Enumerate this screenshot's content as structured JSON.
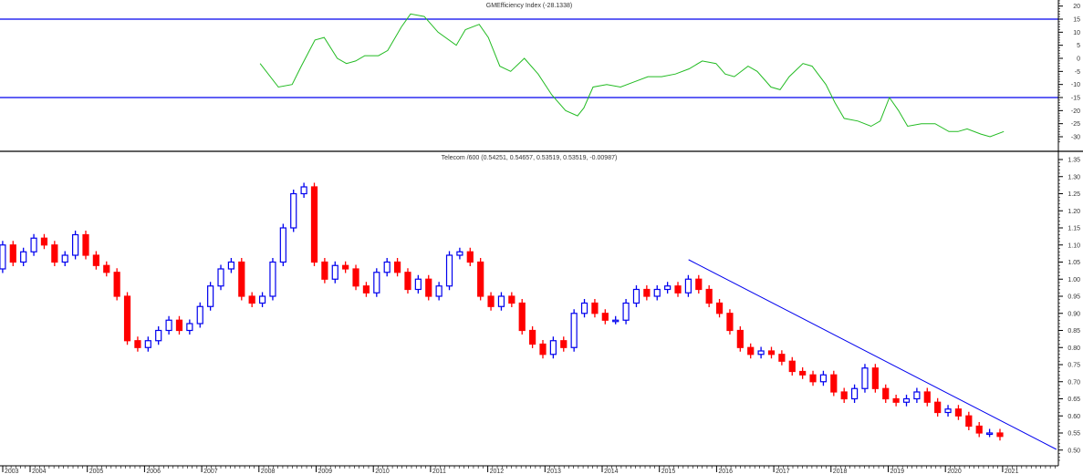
{
  "chart_data": [
    {
      "type": "line",
      "title": "GMEfficiency Index (-28.1338)",
      "yticks": [
        20,
        15,
        10,
        5,
        0,
        -5,
        -10,
        -15,
        -20,
        -25,
        -30
      ],
      "ylim": [
        -34,
        23
      ],
      "reference_lines": [
        15,
        -15
      ],
      "series": [
        {
          "name": "GMEfficiency Index",
          "color": "#22bb22",
          "points": [
            [
              2008.02,
              -2
            ],
            [
              2008.34,
              -11
            ],
            [
              2008.58,
              -10
            ],
            [
              2008.74,
              -3
            ],
            [
              2008.98,
              7
            ],
            [
              2009.14,
              8
            ],
            [
              2009.37,
              0
            ],
            [
              2009.53,
              -2
            ],
            [
              2009.69,
              -1
            ],
            [
              2009.85,
              1
            ],
            [
              2010.09,
              1
            ],
            [
              2010.25,
              3
            ],
            [
              2010.49,
              12
            ],
            [
              2010.65,
              17
            ],
            [
              2010.89,
              16
            ],
            [
              2011.13,
              10
            ],
            [
              2011.45,
              5
            ],
            [
              2011.61,
              11
            ],
            [
              2011.85,
              13
            ],
            [
              2012.01,
              8
            ],
            [
              2012.21,
              -3
            ],
            [
              2012.4,
              -5
            ],
            [
              2012.64,
              0
            ],
            [
              2012.88,
              -6
            ],
            [
              2013.12,
              -14
            ],
            [
              2013.36,
              -20
            ],
            [
              2013.57,
              -22
            ],
            [
              2013.68,
              -19
            ],
            [
              2013.84,
              -11
            ],
            [
              2014.08,
              -10
            ],
            [
              2014.32,
              -11
            ],
            [
              2014.56,
              -9
            ],
            [
              2014.8,
              -7
            ],
            [
              2015.04,
              -7
            ],
            [
              2015.28,
              -6
            ],
            [
              2015.52,
              -4
            ],
            [
              2015.75,
              -1
            ],
            [
              2015.99,
              -2
            ],
            [
              2016.15,
              -6
            ],
            [
              2016.31,
              -7
            ],
            [
              2016.55,
              -3
            ],
            [
              2016.71,
              -5
            ],
            [
              2016.95,
              -11
            ],
            [
              2017.11,
              -12
            ],
            [
              2017.27,
              -7
            ],
            [
              2017.51,
              -2
            ],
            [
              2017.67,
              -3
            ],
            [
              2017.91,
              -10
            ],
            [
              2018.07,
              -17
            ],
            [
              2018.23,
              -23
            ],
            [
              2018.47,
              -24
            ],
            [
              2018.7,
              -26
            ],
            [
              2018.86,
              -24
            ],
            [
              2019.02,
              -15
            ],
            [
              2019.18,
              -20
            ],
            [
              2019.34,
              -26
            ],
            [
              2019.58,
              -25
            ],
            [
              2019.82,
              -25
            ],
            [
              2020.06,
              -28
            ],
            [
              2020.22,
              -28
            ],
            [
              2020.38,
              -27
            ],
            [
              2020.62,
              -29
            ],
            [
              2020.78,
              -30
            ],
            [
              2021.02,
              -28
            ]
          ]
        }
      ]
    },
    {
      "type": "candlestick",
      "title": "Telecom /600 (0.54251, 0.54657, 0.53519, 0.53519, -0.00987)",
      "yticks": [
        "1.35",
        "1.30",
        "1.25",
        "1.20",
        "1.15",
        "1.10",
        "1.05",
        "1.00",
        "0.95",
        "0.90",
        "0.85",
        "0.80",
        "0.75",
        "0.70",
        "0.65",
        "0.60",
        "0.55",
        "0.50"
      ],
      "ylim": [
        0.46,
        1.35
      ],
      "x_ticks": [
        "2003",
        "2004",
        "2005",
        "2006",
        "2007",
        "2008",
        "2009",
        "2010",
        "2011",
        "2012",
        "2013",
        "2014",
        "2015",
        "2016",
        "2017",
        "2018",
        "2019",
        "2020",
        "2021"
      ],
      "start_year": 2003.52,
      "step_years": 0.1816,
      "first_open": 1.03,
      "up_color": "#0000ee",
      "down_color": "#ff0000",
      "closes": [
        1.1,
        1.05,
        1.08,
        1.12,
        1.1,
        1.05,
        1.07,
        1.13,
        1.07,
        1.04,
        1.02,
        0.95,
        0.82,
        0.8,
        0.82,
        0.85,
        0.88,
        0.85,
        0.87,
        0.92,
        0.98,
        1.03,
        1.05,
        0.95,
        0.93,
        0.95,
        1.05,
        1.15,
        1.25,
        1.27,
        1.05,
        1.0,
        1.04,
        1.03,
        0.98,
        0.96,
        1.02,
        1.05,
        1.02,
        0.97,
        1.0,
        0.95,
        0.98,
        1.07,
        1.08,
        1.05,
        0.95,
        0.92,
        0.95,
        0.93,
        0.85,
        0.81,
        0.78,
        0.82,
        0.8,
        0.9,
        0.93,
        0.9,
        0.88,
        0.88,
        0.93,
        0.97,
        0.95,
        0.97,
        0.98,
        0.96,
        1.0,
        0.97,
        0.93,
        0.9,
        0.85,
        0.8,
        0.78,
        0.79,
        0.78,
        0.76,
        0.73,
        0.72,
        0.7,
        0.72,
        0.67,
        0.65,
        0.68,
        0.74,
        0.68,
        0.65,
        0.64,
        0.65,
        0.67,
        0.64,
        0.61,
        0.62,
        0.6,
        0.57,
        0.55,
        0.55,
        0.54
      ],
      "trendline": {
        "color": "#0000ee",
        "from": [
          2015.51,
          1.057
        ],
        "to": [
          2021.94,
          0.502
        ]
      }
    }
  ]
}
